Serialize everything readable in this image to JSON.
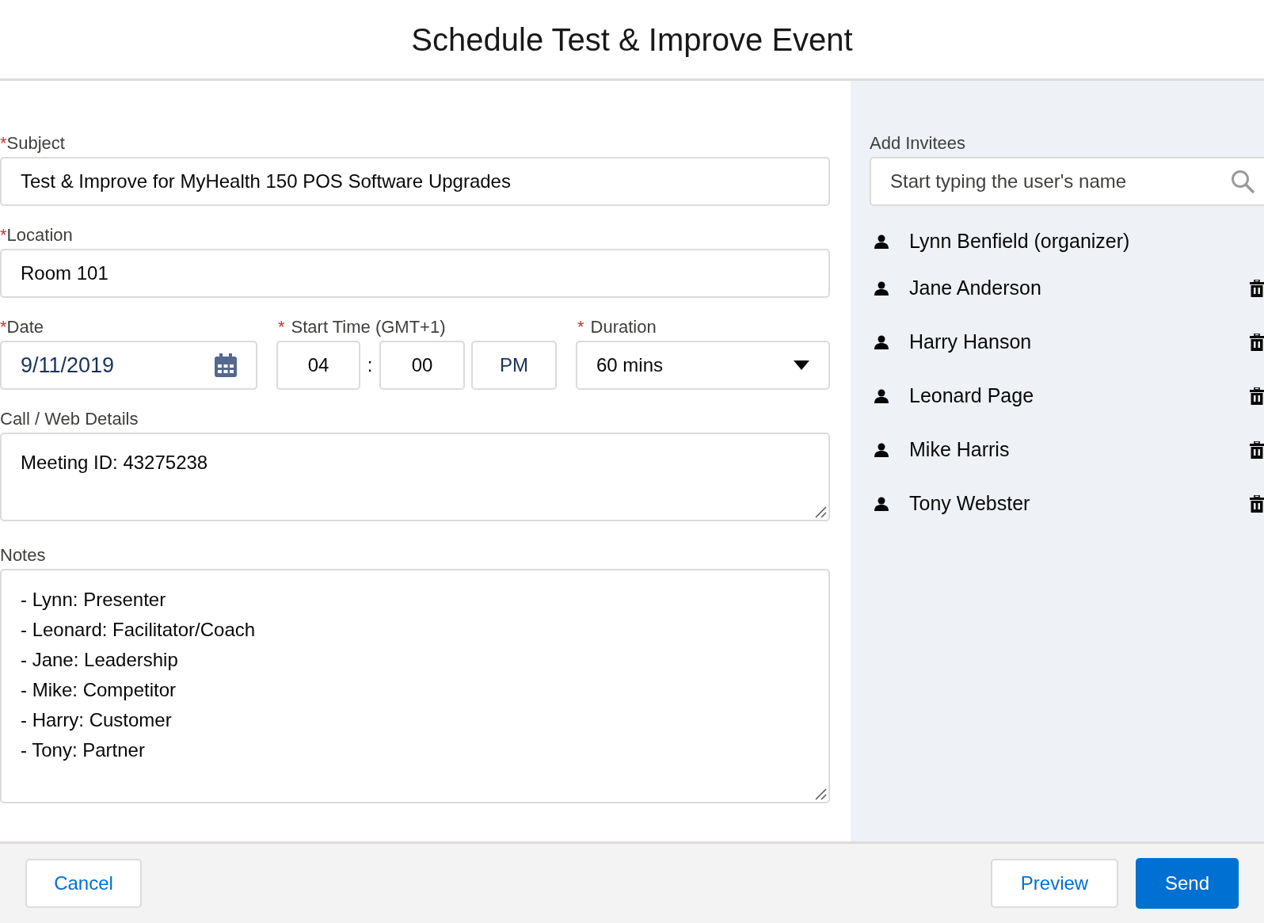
{
  "dialog": {
    "title": "Schedule Test & Improve Event"
  },
  "subject": {
    "label": "Subject",
    "required_mark": "*",
    "value": "Test & Improve for MyHealth 150 POS Software Upgrades"
  },
  "location": {
    "label": "Location",
    "required_mark": "*",
    "value": "Room 101"
  },
  "date": {
    "label": "Date",
    "required_mark": "*",
    "value": "9/11/2019"
  },
  "start_time": {
    "label": "Start Time (GMT+1)",
    "required_mark": "*",
    "hour": "04",
    "separator": ":",
    "minute": "00",
    "period": "PM"
  },
  "duration": {
    "label": "Duration",
    "required_mark": "*",
    "value": "60 mins"
  },
  "call_web_details": {
    "label": "Call / Web Details",
    "value": "Meeting ID: 43275238"
  },
  "notes": {
    "label": "Notes",
    "lines": [
      "- Lynn: Presenter",
      "- Leonard: Facilitator/Coach",
      "- Jane: Leadership",
      "- Mike: Competitor",
      "- Harry: Customer",
      "- Tony: Partner"
    ]
  },
  "invitees": {
    "label": "Add Invitees",
    "placeholder": "Start typing the user's name",
    "people": [
      {
        "name": "Lynn Benfield (organizer)",
        "removable": false
      },
      {
        "name": "Jane Anderson",
        "removable": true
      },
      {
        "name": "Harry Hanson",
        "removable": true
      },
      {
        "name": "Leonard Page",
        "removable": true
      },
      {
        "name": "Mike Harris",
        "removable": true
      },
      {
        "name": "Tony Webster",
        "removable": true
      }
    ]
  },
  "footer": {
    "cancel": "Cancel",
    "preview": "Preview",
    "send": "Send"
  }
}
